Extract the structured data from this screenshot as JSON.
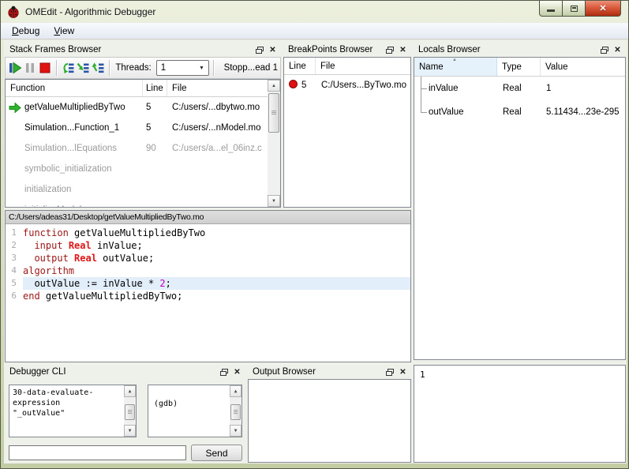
{
  "window": {
    "title": "OMEdit - Algorithmic Debugger",
    "icon": "ladybug-icon",
    "controls": {
      "minimize": "minimize",
      "maximize": "maximize",
      "close": "close"
    }
  },
  "menu": {
    "items": [
      {
        "label": "Debug",
        "accel": "D"
      },
      {
        "label": "View",
        "accel": "V"
      }
    ]
  },
  "stack_frames": {
    "title": "Stack Frames Browser",
    "toolbar": {
      "buttons": [
        "resume",
        "interrupt",
        "stop",
        "step-over",
        "step-into",
        "step-return"
      ],
      "threads_label": "Threads:",
      "threads_value": "1",
      "status": "Stopp...ead 1"
    },
    "columns": [
      "Function",
      "Line",
      "File"
    ],
    "rows": [
      {
        "function": "getValueMultipliedByTwo",
        "line": "5",
        "file": "C:/users/...dbytwo.mo",
        "current": true,
        "active": true
      },
      {
        "function": "Simulation...Function_1",
        "line": "5",
        "file": "C:/users/...nModel.mo",
        "current": false,
        "active": true
      },
      {
        "function": "Simulation...lEquations",
        "line": "90",
        "file": "C:/users/a...el_06inz.c",
        "current": false,
        "active": false
      },
      {
        "function": "symbolic_initialization",
        "line": "",
        "file": "",
        "current": false,
        "active": false
      },
      {
        "function": "initialization",
        "line": "",
        "file": "",
        "current": false,
        "active": false
      },
      {
        "function": "initializeModel",
        "line": "",
        "file": "",
        "current": false,
        "active": false
      }
    ]
  },
  "breakpoints": {
    "title": "BreakPoints Browser",
    "columns": [
      "Line",
      "File"
    ],
    "rows": [
      {
        "line": "5",
        "file": "C:/Users...ByTwo.mo"
      }
    ]
  },
  "locals": {
    "title": "Locals Browser",
    "columns": [
      "Name",
      "Type",
      "Value"
    ],
    "sorted_column": "Name",
    "rows": [
      {
        "name": "inValue",
        "type": "Real",
        "value": "1"
      },
      {
        "name": "outValue",
        "type": "Real",
        "value": "5.11434...23e-295"
      }
    ]
  },
  "editor": {
    "path": "C:/Users/adeas31/Desktop/getValueMultipliedByTwo.mo",
    "current_line": 5,
    "lines": [
      {
        "num": 1,
        "tokens": [
          {
            "t": "function",
            "s": "kw"
          },
          {
            "t": " getValueMultipliedByTwo"
          }
        ]
      },
      {
        "num": 2,
        "tokens": [
          {
            "t": "  "
          },
          {
            "t": "input",
            "s": "kw"
          },
          {
            "t": " "
          },
          {
            "t": "Real",
            "s": "ty"
          },
          {
            "t": " inValue;"
          }
        ]
      },
      {
        "num": 3,
        "tokens": [
          {
            "t": "  "
          },
          {
            "t": "output",
            "s": "kw"
          },
          {
            "t": " "
          },
          {
            "t": "Real",
            "s": "ty"
          },
          {
            "t": " outValue;"
          }
        ]
      },
      {
        "num": 4,
        "tokens": [
          {
            "t": "algorithm",
            "s": "kw"
          }
        ]
      },
      {
        "num": 5,
        "tokens": [
          {
            "t": "  outValue := inValue * "
          },
          {
            "t": "2",
            "s": "num"
          },
          {
            "t": ";"
          }
        ]
      },
      {
        "num": 6,
        "tokens": [
          {
            "t": "end",
            "s": "kw"
          },
          {
            "t": " getValueMultipliedByTwo;"
          }
        ]
      }
    ]
  },
  "debugger_cli": {
    "title": "Debugger CLI",
    "command_log": "30-data-evaluate-expression\n\"_outValue\"",
    "response_log": "(gdb)",
    "input_value": "",
    "send_label": "Send"
  },
  "output_browser": {
    "title": "Output Browser",
    "content": ""
  },
  "eval_panel": {
    "content": "1"
  },
  "colors": {
    "chrome_green": "#c3cda3",
    "close_red": "#b02c10",
    "keyword": "#9c1515",
    "type_red": "#e01616",
    "number_magenta": "#b700b7",
    "current_line_bg": "#e3eefb",
    "breakpoint_red": "#dd1111",
    "arrow_green": "#2db52d"
  }
}
